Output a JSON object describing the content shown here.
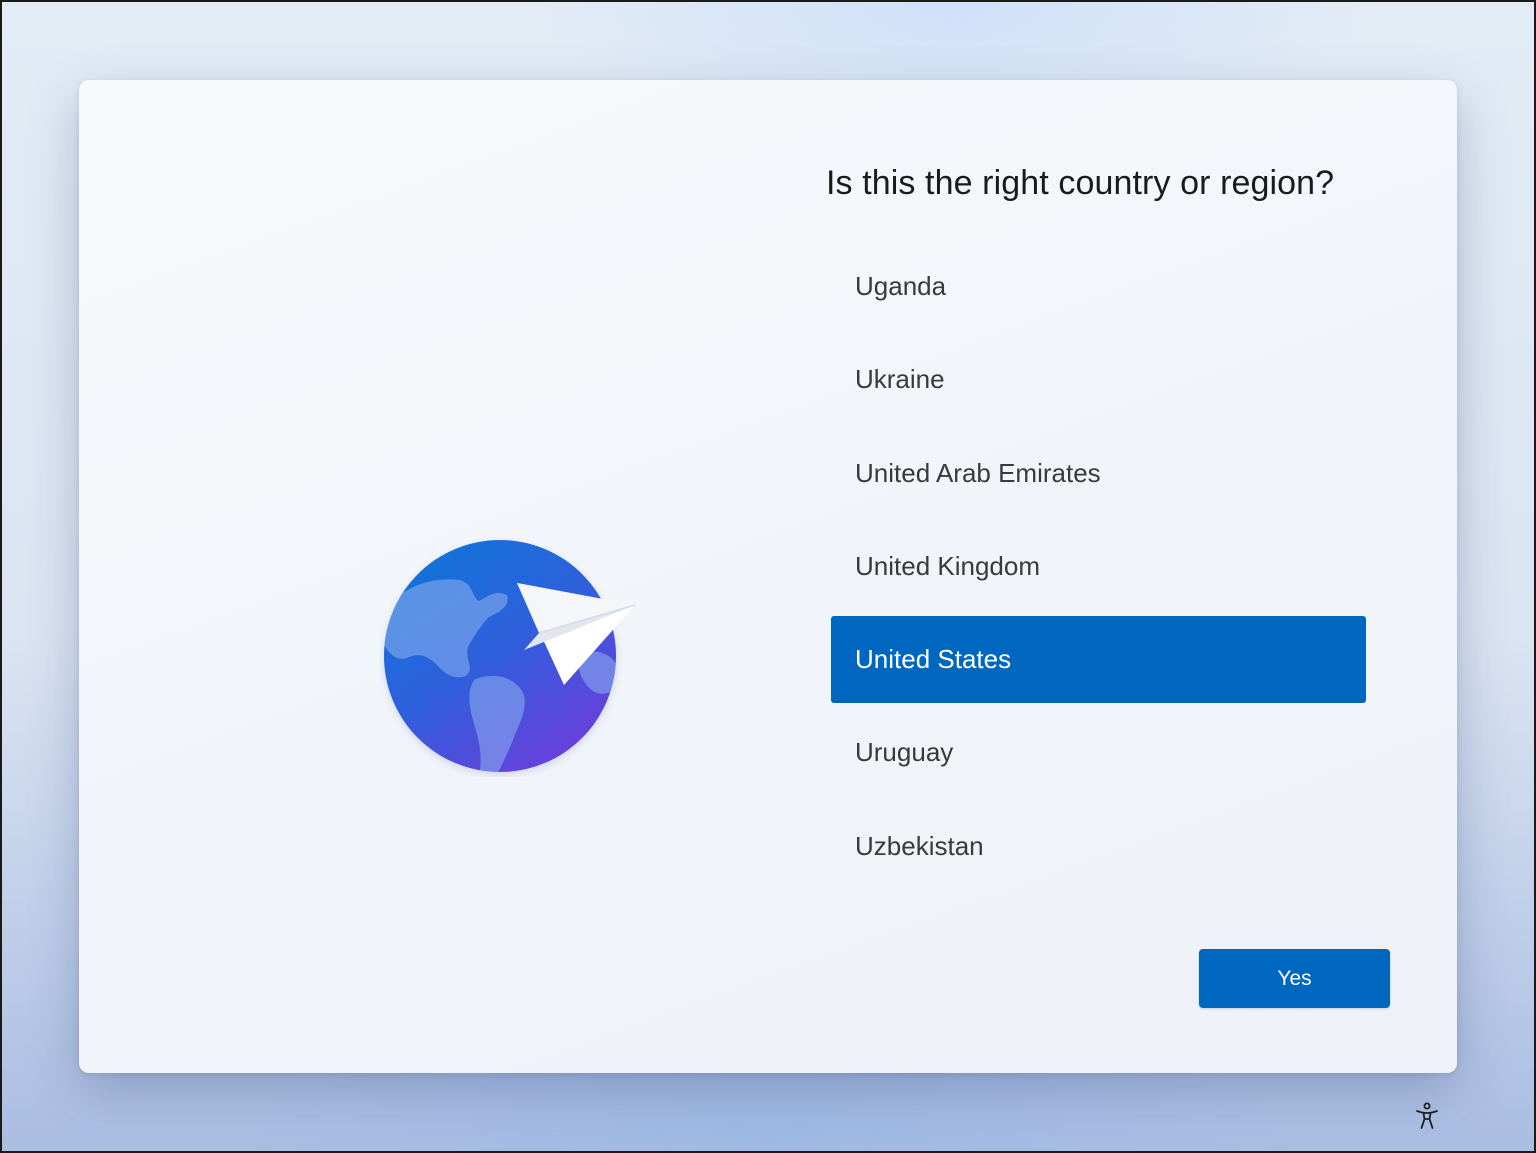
{
  "page": {
    "title": "Is this the right country or region?"
  },
  "countries": [
    {
      "label": "Uganda",
      "selected": false
    },
    {
      "label": "Ukraine",
      "selected": false
    },
    {
      "label": "United Arab Emirates",
      "selected": false
    },
    {
      "label": "United Kingdom",
      "selected": false
    },
    {
      "label": "United States",
      "selected": true
    },
    {
      "label": "Uruguay",
      "selected": false
    },
    {
      "label": "Uzbekistan",
      "selected": false
    }
  ],
  "actions": {
    "yes_label": "Yes"
  },
  "icons": {
    "illustration": "globe-with-paper-plane-icon",
    "accessibility": "accessibility-icon"
  },
  "colors": {
    "accent": "#0067c0",
    "selected_text": "#ffffff",
    "item_text": "#3a3a3a",
    "title_text": "#1b1b1b"
  }
}
